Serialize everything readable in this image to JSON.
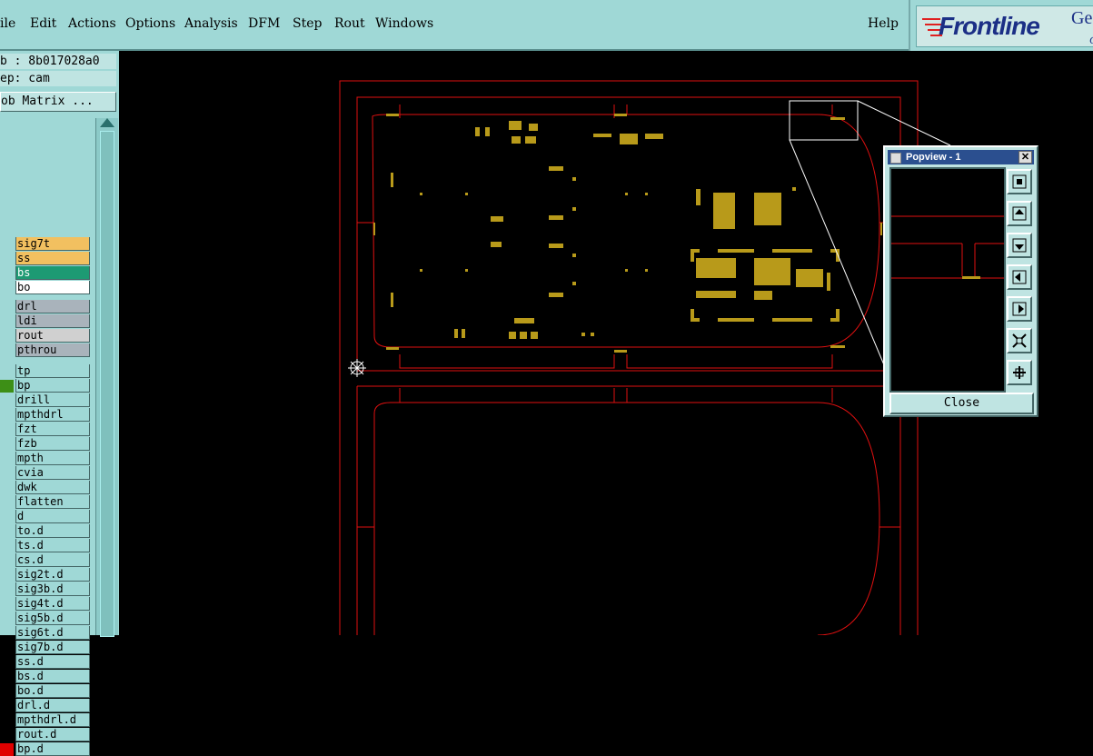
{
  "menubar": {
    "items": [
      "ile",
      "Edit",
      "Actions",
      "Options",
      "Analysis",
      "DFM",
      "Step",
      "Rout",
      "Windows"
    ],
    "help": "Help"
  },
  "logo": {
    "brand": "Frontline",
    "suffix": "Ge",
    "sub": "G"
  },
  "info": {
    "job": "b : 8b017028a0",
    "step": "ep: cam"
  },
  "matrix_button": "ob Matrix ...",
  "layers": [
    {
      "name": "sig7t",
      "bg": "#f2c060",
      "sw": ""
    },
    {
      "name": "ss",
      "bg": "#f2c060",
      "sw": ""
    },
    {
      "name": "bs",
      "bg": "#1d9a73",
      "sw": ""
    },
    {
      "name": "bo",
      "bg": "#ffffff",
      "sw": ""
    },
    {
      "name": "drl",
      "bg": "#a9b3bb",
      "sw": ""
    },
    {
      "name": "ldi",
      "bg": "#a9b3bb",
      "sw": ""
    },
    {
      "name": "rout",
      "bg": "#d0d0d0",
      "sw": ""
    },
    {
      "name": "pthrou",
      "bg": "#a9b3bb",
      "sw": ""
    },
    {
      "name": "tp",
      "bg": "",
      "sw": ""
    },
    {
      "name": "bp",
      "bg": "",
      "sw": "#3d8f16"
    },
    {
      "name": "drill",
      "bg": "",
      "sw": ""
    },
    {
      "name": "mpthdrl",
      "bg": "",
      "sw": ""
    },
    {
      "name": "fzt",
      "bg": "",
      "sw": ""
    },
    {
      "name": "fzb",
      "bg": "",
      "sw": ""
    },
    {
      "name": "mpth",
      "bg": "",
      "sw": ""
    },
    {
      "name": "cvia",
      "bg": "",
      "sw": ""
    },
    {
      "name": "dwk",
      "bg": "",
      "sw": ""
    },
    {
      "name": "flatten",
      "bg": "",
      "sw": ""
    },
    {
      "name": "d",
      "bg": "",
      "sw": ""
    },
    {
      "name": "to.d",
      "bg": "",
      "sw": ""
    },
    {
      "name": "ts.d",
      "bg": "",
      "sw": ""
    },
    {
      "name": "cs.d",
      "bg": "",
      "sw": ""
    },
    {
      "name": "sig2t.d",
      "bg": "",
      "sw": ""
    },
    {
      "name": "sig3b.d",
      "bg": "",
      "sw": ""
    },
    {
      "name": "sig4t.d",
      "bg": "",
      "sw": ""
    },
    {
      "name": "sig5b.d",
      "bg": "",
      "sw": ""
    },
    {
      "name": "sig6t.d",
      "bg": "",
      "sw": ""
    },
    {
      "name": "sig7b.d",
      "bg": "",
      "sw": ""
    },
    {
      "name": "ss.d",
      "bg": "",
      "sw": ""
    },
    {
      "name": "bs.d",
      "bg": "",
      "sw": ""
    },
    {
      "name": "bo.d",
      "bg": "",
      "sw": ""
    },
    {
      "name": "drl.d",
      "bg": "",
      "sw": ""
    },
    {
      "name": "mpthdrl.d",
      "bg": "",
      "sw": ""
    },
    {
      "name": "rout.d",
      "bg": "",
      "sw": ""
    },
    {
      "name": "bp.d",
      "bg": "",
      "sw": "#e00000"
    }
  ],
  "colors": {
    "outline": "#e01010",
    "pads": "#b89a1a",
    "zoomline": "#ffffff"
  },
  "popview": {
    "title": "Popview - 1",
    "close_glyph": "✕",
    "close_label": "Close",
    "tools": [
      "zoom-fit-icon",
      "pan-up-icon",
      "pan-down-icon",
      "pan-left-icon",
      "pan-right-icon",
      "zoom-out-icon",
      "zoom-in-icon"
    ]
  }
}
